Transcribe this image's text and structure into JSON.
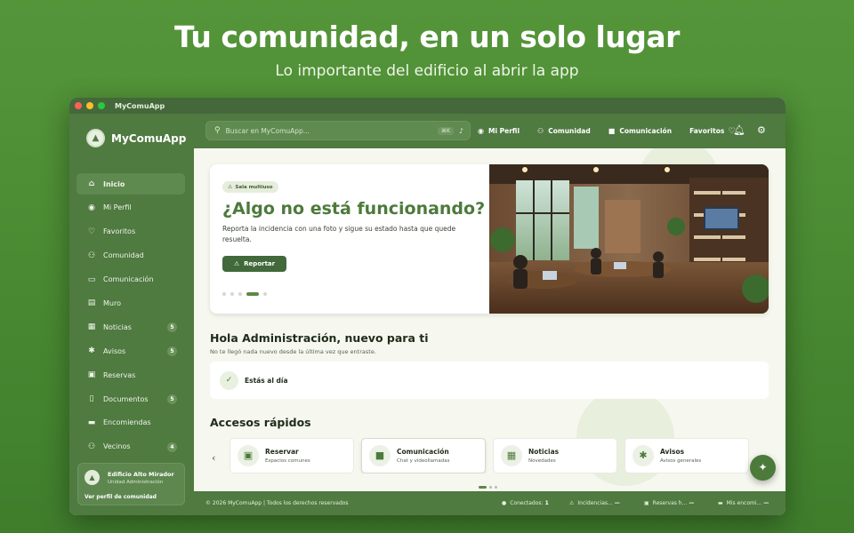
{
  "hero": {
    "title": "Tu comunidad, en un solo lugar",
    "subtitle": "Lo importante del edificio al abrir la app"
  },
  "window": {
    "title": "MyComuApp"
  },
  "brand": {
    "name": "MyComuApp",
    "logo_icon": "mountain-logo-icon"
  },
  "search": {
    "placeholder": "Buscar en MyComuApp...",
    "shortcut": "⌘K",
    "icon": "search-icon",
    "mic_icon": "microphone-icon"
  },
  "topnav": {
    "links": [
      {
        "label": "Mi Perfil",
        "icon": "user-icon"
      },
      {
        "label": "Comunidad",
        "icon": "users-icon"
      },
      {
        "label": "Comunicación",
        "icon": "video-icon"
      },
      {
        "label": "Favoritos",
        "icon": "heart-icon"
      }
    ],
    "bell_icon": "bell-icon",
    "settings_icon": "gear-icon"
  },
  "sidebar": {
    "items": [
      {
        "label": "Inicio",
        "icon": "home-icon",
        "badge": ""
      },
      {
        "label": "Mi Perfil",
        "icon": "user-icon",
        "badge": ""
      },
      {
        "label": "Favoritos",
        "icon": "heart-icon",
        "badge": ""
      },
      {
        "label": "Comunidad",
        "icon": "users-icon",
        "badge": ""
      },
      {
        "label": "Comunicación",
        "icon": "chat-icon",
        "badge": ""
      },
      {
        "label": "Muro",
        "icon": "wall-icon",
        "badge": ""
      },
      {
        "label": "Noticias",
        "icon": "newspaper-icon",
        "badge": "5"
      },
      {
        "label": "Avisos",
        "icon": "megaphone-icon",
        "badge": "5"
      },
      {
        "label": "Reservas",
        "icon": "calendar-icon",
        "badge": ""
      },
      {
        "label": "Documentos",
        "icon": "document-icon",
        "badge": "5"
      },
      {
        "label": "Encomiendas",
        "icon": "truck-icon",
        "badge": ""
      },
      {
        "label": "Vecinos",
        "icon": "neighbors-icon",
        "badge": "4"
      }
    ],
    "active_index": 0,
    "community_card": {
      "name": "Edificio Alto Mirador",
      "role": "Unidad Administración",
      "link": "Ver perfil de comunidad"
    }
  },
  "banner": {
    "tag": "Sala multiuso",
    "title": "¿Algo no está funcionando?",
    "description": "Reporta la incidencia con una foto y sigue su estado hasta que quede resuelta.",
    "button": "Reportar",
    "slide_count": 5,
    "active_slide": 3
  },
  "greeting": {
    "title": "Hola Administración, nuevo para ti",
    "subtitle": "No te llegó nada nuevo desde la última vez que entraste.",
    "status": "Estás al día"
  },
  "quick_access": {
    "title": "Accesos rápidos",
    "cards": [
      {
        "title": "Reservar",
        "subtitle": "Espacios comunes",
        "icon": "calendar-icon"
      },
      {
        "title": "Comunicación",
        "subtitle": "Chat y videollamadas",
        "icon": "video-icon"
      },
      {
        "title": "Noticias",
        "subtitle": "Novedades",
        "icon": "newspaper-icon"
      },
      {
        "title": "Avisos",
        "subtitle": "Avisos generales",
        "icon": "megaphone-icon"
      }
    ],
    "selected_index": 1,
    "page_count": 3,
    "active_page": 0
  },
  "footer": {
    "copyright": "© 2026 MyComuApp | Todos los derechos reservados",
    "stats": [
      {
        "label": "Conectados:",
        "value": "1",
        "icon": "status-dot-icon"
      },
      {
        "label": "Incidencias...",
        "value": "—",
        "icon": "warning-icon"
      },
      {
        "label": "Reservas h...",
        "value": "—",
        "icon": "calendar-icon"
      },
      {
        "label": "Mis encomi...",
        "value": "—",
        "icon": "truck-icon"
      }
    ]
  },
  "colors": {
    "brand_green": "#4f7a40",
    "accent_green": "#4d7a3c",
    "background": "#f6f8ef"
  }
}
